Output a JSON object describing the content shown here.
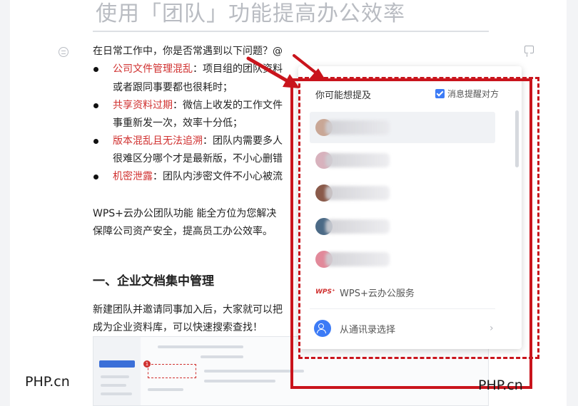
{
  "doc": {
    "title": "使用「团队」功能提高办公效率",
    "intro": "在日常工作中，你是否常遇到以下问题？@",
    "bullets": [
      {
        "key": "公司文件管理混乱",
        "text": "：项目组的团队资料",
        "cont": "或者跟同事要都也很耗时；"
      },
      {
        "key": "共享资料过期",
        "text": "：微信上收发的工作文件",
        "cont": "事重新发一次，效率十分低；"
      },
      {
        "key": "版本混乱且无法追溯",
        "text": "：团队内需要多人",
        "cont": "很难区分哪个才是最新版，不小心删错"
      },
      {
        "key": "机密泄露",
        "text": "：团队内涉密文件不小心被流",
        "cont": ""
      }
    ],
    "para2_line1": "WPS+云办公团队功能 能全方位为您解决",
    "para2_line2": "保障公司资产安全，提高员工办公效率。",
    "heading1": "一、企业文档集中管理",
    "para3_line1": "新建团队并邀请同事加入后，大家就可以把",
    "para3_line2": "成为企业资料库，可以快速搜索查找！"
  },
  "mention_popup": {
    "title": "你可能想提及",
    "notify_label": "消息提醒对方",
    "notify_checked": true,
    "users": [
      {
        "avatar_color": "#c9a796"
      },
      {
        "avatar_color": "#d8b2bd"
      },
      {
        "avatar_color": "#8a5a4a"
      },
      {
        "avatar_color": "#4b6a86"
      },
      {
        "avatar_color": "#e2899a"
      }
    ],
    "service_logo": "WPS⁺",
    "service_label": "WPS+云办公服务",
    "contacts_label": "从通讯录选择",
    "chevron": "›"
  },
  "watermarks": [
    "PHP.cn",
    "PHP.cn"
  ],
  "colors": {
    "accent_red": "#c9141c",
    "brand_blue": "#3c7bf6",
    "text_red": "#d0302f"
  }
}
